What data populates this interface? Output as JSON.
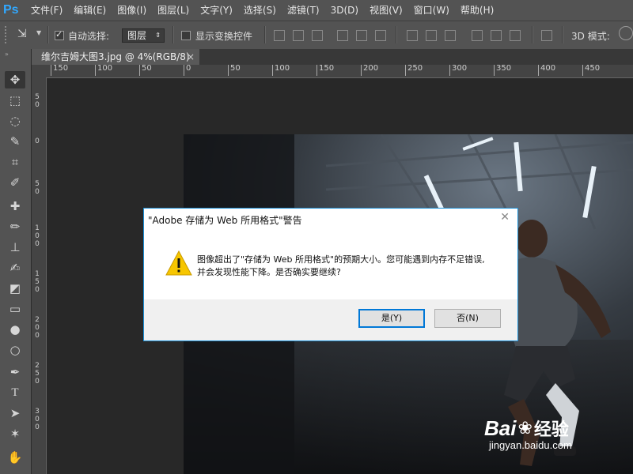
{
  "app": {
    "logo": "Ps"
  },
  "menu": [
    "文件(F)",
    "编辑(E)",
    "图像(I)",
    "图层(L)",
    "文字(Y)",
    "选择(S)",
    "滤镜(T)",
    "3D(D)",
    "视图(V)",
    "窗口(W)",
    "帮助(H)"
  ],
  "options_bar": {
    "auto_select_label": "自动选择:",
    "auto_select_checked": true,
    "layer_select_value": "图层",
    "show_transform_label": "显示变换控件",
    "show_transform_checked": false,
    "mode_3d_label": "3D 模式:"
  },
  "document_tab": {
    "title": "维尔吉姆大图3.jpg @ 4%(RGB/8)",
    "close": "×"
  },
  "ruler": {
    "horizontal": [
      "150",
      "100",
      "50",
      "0",
      "50",
      "100",
      "150",
      "200",
      "250",
      "300",
      "350",
      "400",
      "450"
    ],
    "vertical": [
      "5 0",
      "0",
      "5 0",
      "1 0 0",
      "1 5 0",
      "2 0 0",
      "2 5 0",
      "3 0 0"
    ]
  },
  "dialog": {
    "title": "\"Adobe 存储为 Web 所用格式\"警告",
    "close": "✕",
    "icon": "warning-icon",
    "message_line1": "图像超出了\"存储为 Web 所用格式\"的预期大小。您可能遇到内存不足错误,",
    "message_line2": "并会发现性能下降。是否确实要继续?",
    "yes_label": "是(Y)",
    "no_label": "否(N)"
  },
  "watermark": {
    "brand": "Bai",
    "brand2": "经验",
    "url": "jingyan.baidu.com"
  },
  "colors": {
    "accent": "#0078d7",
    "ps_blue": "#31a8ff",
    "warning": "#f7c600"
  }
}
